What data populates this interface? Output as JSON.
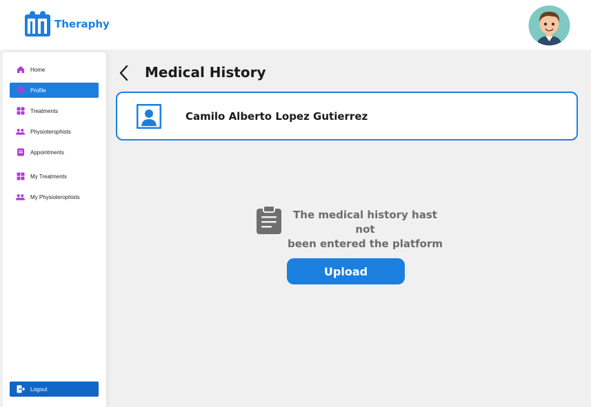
{
  "app": {
    "name": "Theraphy"
  },
  "colors": {
    "accent": "#1b7fe0",
    "nav_icon": "#b23bd6",
    "logout_bg": "#0f66c7"
  },
  "sidebar": {
    "items": [
      {
        "label": "Home",
        "icon": "home-icon"
      },
      {
        "label": "Profile",
        "icon": "user-circle-icon",
        "active": true
      },
      {
        "label": "Treatments",
        "icon": "grid-icon"
      },
      {
        "label": "Physioterophists",
        "icon": "group-icon"
      },
      {
        "label": "Appointments",
        "icon": "document-icon"
      },
      {
        "label": "My Treatments",
        "icon": "grid-icon"
      },
      {
        "label": "My Physioterophists",
        "icon": "group-icon"
      }
    ],
    "logout_label": "Logout"
  },
  "page": {
    "title": "Medical History"
  },
  "patient": {
    "name": "Camilo Alberto Lopez Gutierrez"
  },
  "empty_state": {
    "line1": "The medical history hast not",
    "line2": "been entered the platform",
    "icon": "clipboard-icon"
  },
  "upload": {
    "label": "Upload"
  }
}
